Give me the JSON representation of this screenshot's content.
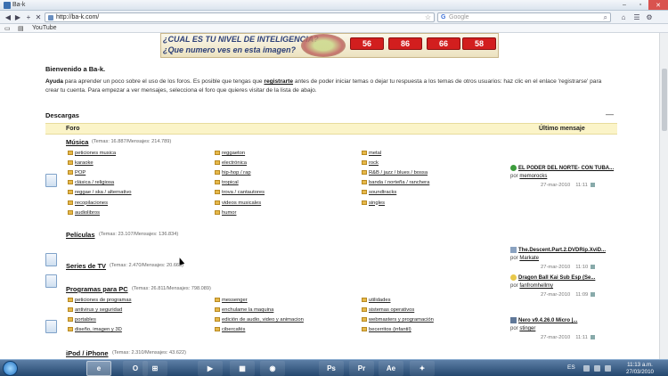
{
  "window": {
    "title": "Ba-k"
  },
  "browser": {
    "url": "http://ba-k.com/",
    "search_placeholder": "Google",
    "bookmarks": [
      "YouTube"
    ]
  },
  "banner": {
    "line1": "¿CUAL ES TU NIVEL DE INTELIGENCIA?",
    "line2": "¿Que numero ves en esta imagen?",
    "options": [
      "56",
      "86",
      "66",
      "58"
    ]
  },
  "page": {
    "welcome": "Bienvenido a Ba-k.",
    "help_label": "Ayuda",
    "help_text_1": "para aprender un poco sobre el uso de los foros. Es posible que tengas que",
    "help_link": "registrarte",
    "help_text_2": "antes de poder iniciar temas o dejar tu respuesta a los temas de otros usuarios: haz clic en el enlace 'registrarse' para crear tu cuenta. Para empezar a ver mensajes, selecciona el foro que quieres visitar de la lista de abajo.",
    "section": "Descargas",
    "collapse_icon": "minus-icon",
    "col_forum": "Foro",
    "col_last": "Último mensaje"
  },
  "forums": [
    {
      "name": "Música",
      "stats": "(Temas: 16.887/Mensajes: 214.789)",
      "subforums": [
        [
          "peticiones musica",
          "reggaeton",
          "metal"
        ],
        [
          "karaoke",
          "electrónica",
          "rock"
        ],
        [
          "POP",
          "hip-hop / rap",
          "R&B / jazz / blues / bossa"
        ],
        [
          "clásica / religiosa",
          "tropical",
          "banda / norteña / ranchera"
        ],
        [
          "reggae / ska / alternativo",
          "trova / cantautores",
          "soundtracks"
        ],
        [
          "recopilaciones",
          "videos musicales",
          "singles"
        ],
        [
          "audiolibros",
          "humor",
          ""
        ]
      ],
      "last": {
        "title": "EL PODER DEL NORTE- CON TUBA...",
        "by_label": "por",
        "user": "memorocks",
        "date": "27-mar-2010",
        "time": "11:11",
        "icon": "smiley-icon"
      }
    },
    {
      "name": "Películas",
      "stats": "(Temas: 23.107/Mensajes: 136.834)",
      "subforums": [],
      "last": {
        "title": "The.Descent.Part.2.DVDRip.XviD...",
        "by_label": "por",
        "user": "Markate",
        "date": "27-mar-2010",
        "time": "11:10",
        "icon": "document-icon"
      }
    },
    {
      "name": "Series de TV",
      "stats": "(Temas: 2.470/Mensajes: 20.663)",
      "subforums": [],
      "last": {
        "title": "Dragon Ball Kai Sub Esp (Se...",
        "by_label": "por",
        "user": "fanfromhellmy",
        "date": "27-mar-2010",
        "time": "11:09",
        "icon": "thumbs-up-icon"
      }
    },
    {
      "name": "Programas para PC",
      "stats": "(Temas: 26.811/Mensajes: 798.089)",
      "subforums": [
        [
          "peticiones de programas",
          "messenger",
          "utilidades"
        ],
        [
          "antivirus y seguridad",
          "enchulame la maquina",
          "sistemas operativos"
        ],
        [
          "portables",
          "edición de audio, video y animacion",
          "webmasters y programación"
        ],
        [
          "diseño, imagen y 3D",
          "cibercafés",
          "becerritos (infantil)"
        ]
      ],
      "last": {
        "title": "Nero v9.4.26.0 Micro |...",
        "by_label": "por",
        "user": "stinger",
        "date": "27-mar-2010",
        "time": "11:11",
        "icon": "image-icon"
      }
    },
    {
      "name": "iPod / iPhone",
      "stats": "(Temas: 2.310/Mensajes: 43.622)",
      "subforums": [],
      "last": {
        "title": "DESACTIVA EL EDGE CON UN SOLO...",
        "by_label": "por",
        "user": "oscarquaplo",
        "date": "",
        "time": "",
        "icon": "smiley-icon"
      }
    }
  ],
  "taskbar": {
    "apps": [
      "ie-icon",
      "opera-icon",
      "windows-icon",
      "player-icon",
      "explorer-icon",
      "chrome-icon",
      "ps-icon",
      "pr-icon",
      "ae-icon",
      "game-icon"
    ],
    "app_labels": [
      "e",
      "O",
      "⊞",
      "▶",
      "▦",
      "◉",
      "Ps",
      "Pr",
      "Ae",
      "✦"
    ],
    "lang": "ES",
    "time": "11:13 a.m.",
    "date": "27/03/2010"
  }
}
